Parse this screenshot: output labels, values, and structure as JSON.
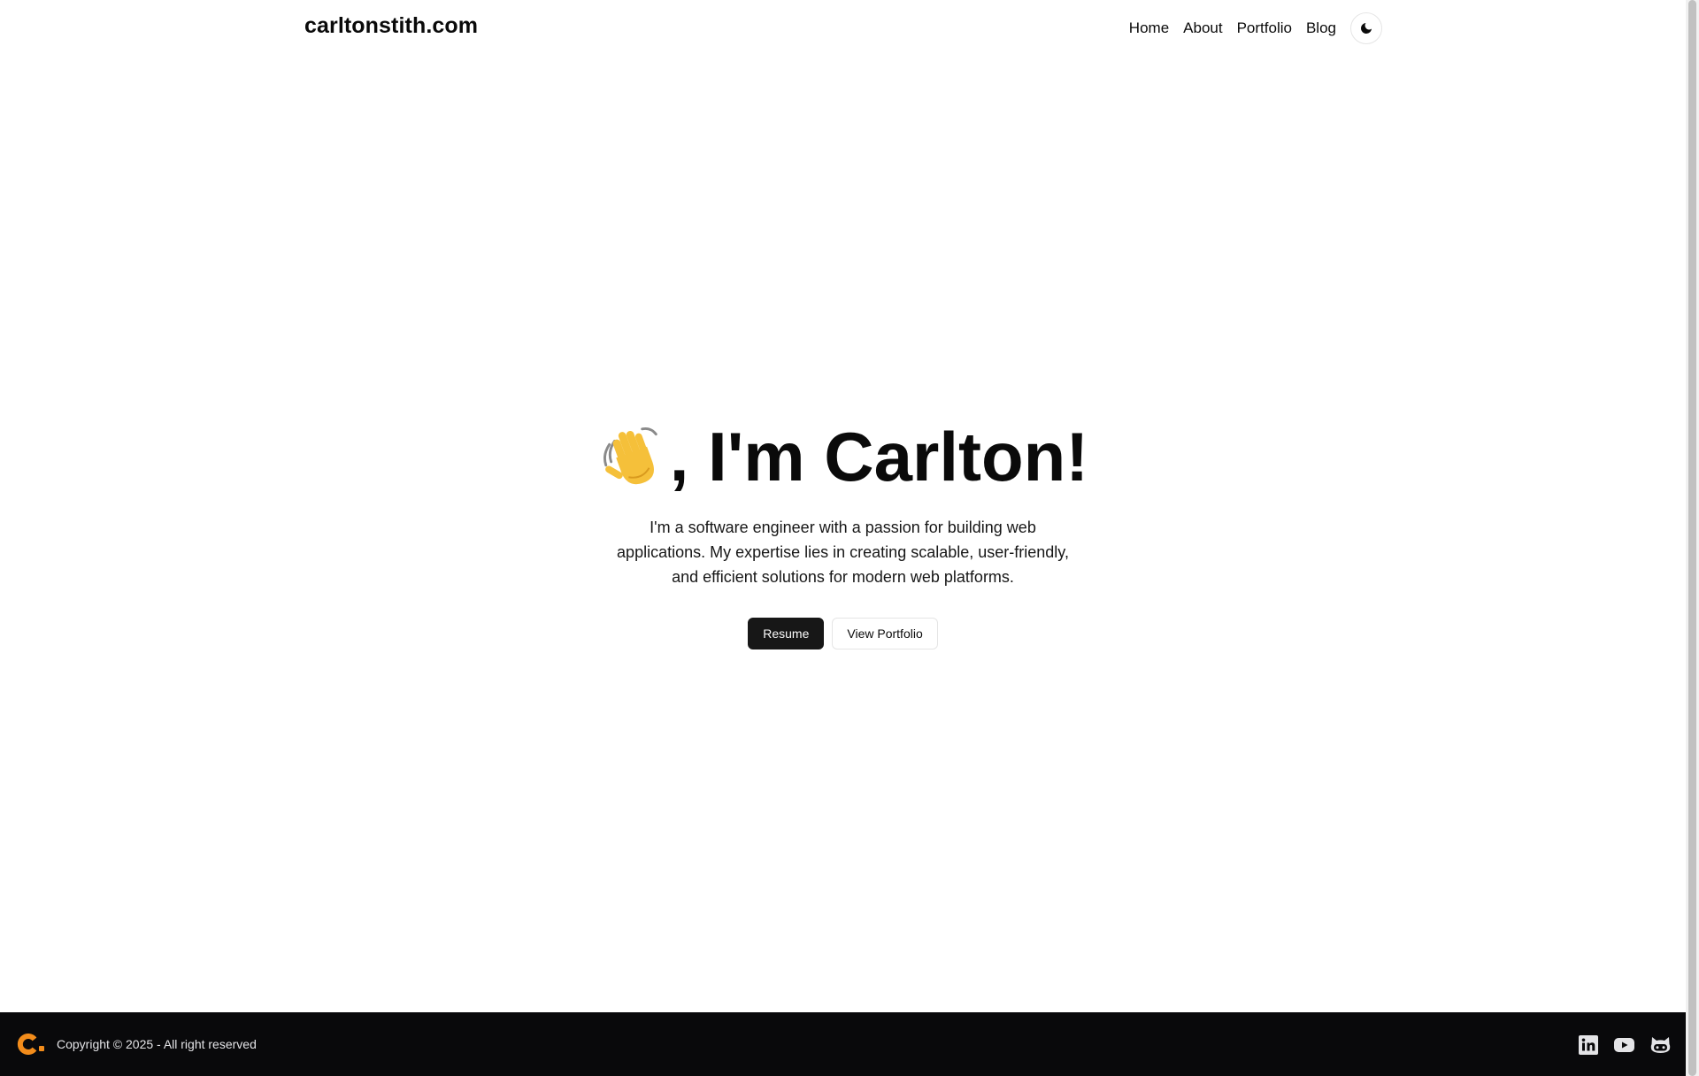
{
  "header": {
    "brand": "carltonstith.com",
    "nav": [
      {
        "label": "Home"
      },
      {
        "label": "About"
      },
      {
        "label": "Portfolio"
      },
      {
        "label": "Blog"
      }
    ],
    "theme_toggle_icon": "moon-icon"
  },
  "hero": {
    "emoji": "👋",
    "title": ", I'm Carlton!",
    "description": "I'm a software engineer with a passion for building web applications. My expertise lies in creating scalable, user-friendly, and efficient solutions for modern web platforms.",
    "primary_button": "Resume",
    "secondary_button": "View Portfolio"
  },
  "footer": {
    "logo_icon": "c-logo-icon",
    "copyright": "Copyright © 2025 - All right reserved",
    "socials": [
      {
        "icon": "linkedin-icon"
      },
      {
        "icon": "youtube-icon"
      },
      {
        "icon": "github-icon"
      }
    ]
  },
  "colors": {
    "background": "#ffffff",
    "text": "#0a0a0a",
    "primary_button": "#171717",
    "footer_background": "#09090b",
    "footer_text": "#e4e4e7",
    "logo_accent": "#f28c1b"
  }
}
